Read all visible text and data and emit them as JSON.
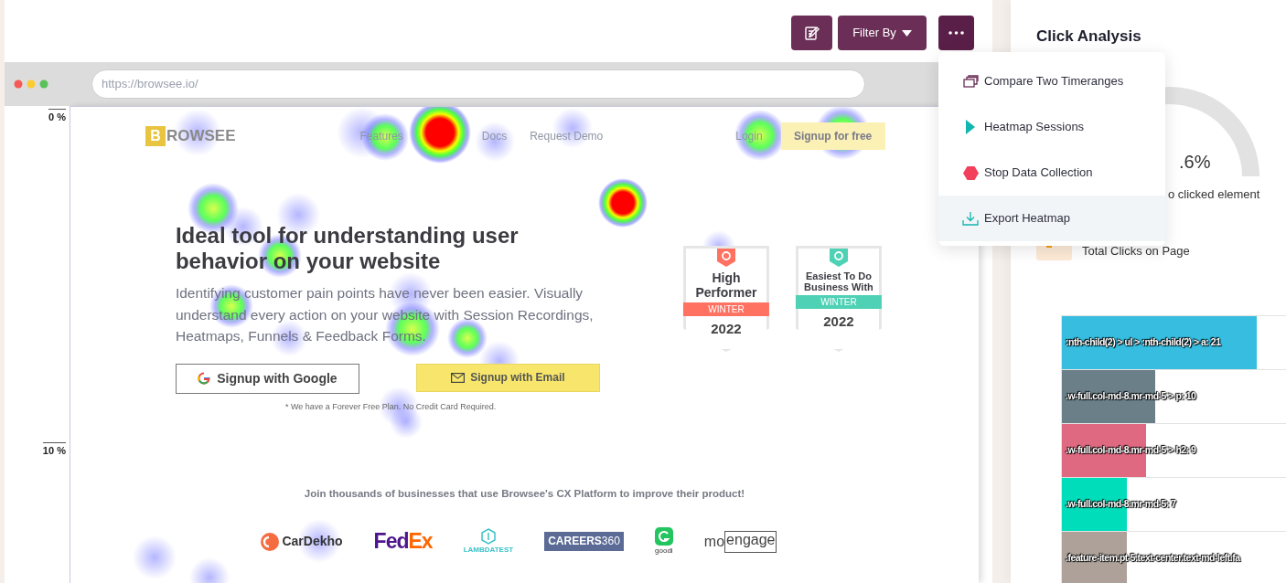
{
  "toolbar": {
    "buttons": [
      {
        "kind": "edit"
      },
      {
        "kind": "filter",
        "label": "Filter By"
      },
      {
        "kind": "more"
      }
    ]
  },
  "menu": {
    "items": [
      {
        "label": "Compare Two Timeranges",
        "selected": false
      },
      {
        "label": "Heatmap Sessions",
        "selected": false
      },
      {
        "label": "Stop Data Collection",
        "selected": false
      },
      {
        "label": "Export Heatmap",
        "selected": true
      }
    ]
  },
  "browser": {
    "url": "https://browsee.io/",
    "ruler": [
      "0 %",
      "10 %"
    ]
  },
  "site": {
    "logo_mark": "B",
    "logo_text": "ROWSEE",
    "nav": [
      "Features",
      "Docs",
      "Request Demo"
    ],
    "login": "Login",
    "signup": "Signup for free",
    "heading": "Ideal tool for understanding user behavior on your website",
    "paragraph": "Identifying customer pain points have never been easier. Visually understand every action on your website with Session Recordings, Heatmaps, Funnels & Feedback Forms.",
    "google_button": "Signup with Google",
    "email_button": "Signup with Email",
    "note": "* We have a Forever Free Plan. No Credit Card Required.",
    "badges": [
      {
        "lines": [
          "High",
          "Performer"
        ],
        "season": "WINTER",
        "year": "2022",
        "color": "#ff7262"
      },
      {
        "lines": [
          "Easiest To Do",
          "Business With"
        ],
        "season": "WINTER",
        "year": "2022",
        "color": "#4fd1b5"
      }
    ],
    "trust": "Join thousands of businesses that use Browsee's CX Platform to improve their product!",
    "logos": [
      {
        "kind": "cardekho",
        "text": "CarDekho"
      },
      {
        "kind": "fedex",
        "parts": [
          "Fed",
          "Ex"
        ]
      },
      {
        "kind": "lambda",
        "text": "LAMBDATEST"
      },
      {
        "kind": "careers",
        "parts": [
          "CAREERS",
          "360"
        ]
      },
      {
        "kind": "goodi",
        "text": "goodi"
      },
      {
        "kind": "moengage",
        "parts": [
          "mo",
          "engage"
        ]
      }
    ]
  },
  "panel": {
    "title": "Click Analysis",
    "gauge_value": ".6%",
    "gauge_caption": "o clicked element",
    "total_label": "Total Clicks on Page",
    "element_bars": [
      {
        "label": ":nth-child(2) > ul > :nth-child(2) > a: 21",
        "color": "#36bde0",
        "level": 0.87
      },
      {
        "label": ".w-full.col-md-8.mr-md-5 > p: 10",
        "color": "#6a7f88",
        "level": 0.415
      },
      {
        "label": ".w-full.col-md-8.mr-md-5 > h2: 9",
        "color": "#de6981",
        "level": 0.374
      },
      {
        "label": ".w-full.col-md-8.mr-md-5: 7",
        "color": "#00ddbb",
        "level": 0.29
      },
      {
        "label": ".feature-item.pt-5.text-center.text-md-left.fa",
        "color": "#ada199",
        "level": 0.29
      }
    ]
  }
}
